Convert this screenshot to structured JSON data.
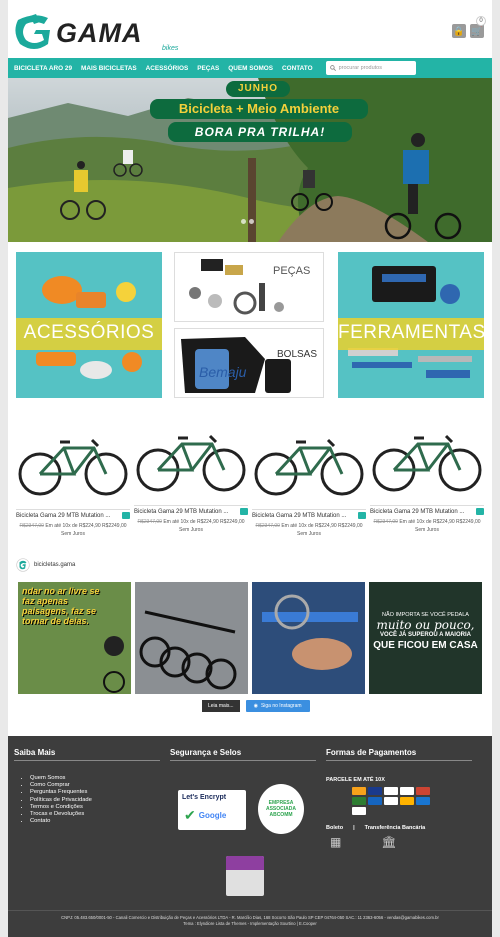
{
  "header": {
    "brand": "GAMA",
    "brand_sub": "bikes",
    "cart_count": "0"
  },
  "nav": {
    "items": [
      "BICICLETA ARO 29",
      "MAIS BICICLETAS",
      "ACESSÓRIOS",
      "PEÇAS",
      "QUEM SOMOS",
      "CONTATO"
    ],
    "search_placeholder": "procurar produtos"
  },
  "hero": {
    "line1": "JUNHO",
    "line2": "Bicicleta + Meio Ambiente",
    "line3": "BORA PRA TRILHA!"
  },
  "categories": {
    "accessories": "ACESSÓRIOS",
    "parts": "PEÇAS",
    "bags": "BOLSAS",
    "tools": "FERRAMENTAS",
    "bags_brand": "Bemaju"
  },
  "products": [
    {
      "name": "Bicicleta Gama 29 MTB Mutation ...",
      "old_price": "R$2347,00",
      "installment": "Em até 10x de R$224,90",
      "price": "R$2249,00",
      "note": "Sem Juros"
    },
    {
      "name": "Bicicleta Gama 29 MTB Mutation ...",
      "old_price": "R$2347,00",
      "installment": "Em até 10x de R$224,90",
      "price": "R$2249,00",
      "note": "Sem Juros"
    },
    {
      "name": "Bicicleta Gama 29 MTB Mutation ...",
      "old_price": "R$2347,00",
      "installment": "Em até 10x de R$224,90",
      "price": "R$2249,00",
      "note": "Sem Juros"
    },
    {
      "name": "Bicicleta Gama 29 MTB Mutation ...",
      "old_price": "R$2347,00",
      "installment": "Em até 10x de R$224,90",
      "price": "R$2249,00",
      "note": "Sem Juros"
    }
  ],
  "instagram": {
    "handle": "bicicletas.gama",
    "post1": "ndar no ar livre se faz apenas paisagens, faz se tornar de deias.",
    "post4a": "NÃO IMPORTA SE VOCÊ PEDALA",
    "post4b": "muito ou pouco,",
    "post4c": "VOCÊ JÁ SUPEROU A MAIORIA",
    "post4d": "QUE FICOU EM CASA",
    "load_more": "Leia mais...",
    "follow": "Siga no Instagram"
  },
  "footer": {
    "col1_title": "Saiba Mais",
    "links": [
      "Quem Somos",
      "Como Comprar",
      "Perguntas Frequentes",
      "Políticas de Privacidade",
      "Termos e Condições",
      "Trocas e Devoluções",
      "Contato"
    ],
    "col2_title": "Segurança e Selos",
    "letsencrypt": "Let's Encrypt",
    "google": "Google",
    "abcomm": "EMPRESA ASSOCIADA ABCOMM",
    "col3_title": "Formas de Pagamentos",
    "parcel": "PARCELE EM ATÉ 10X",
    "boleto": "Boleto",
    "sep": "|",
    "transfer": "Transferência Bancária",
    "copyright": "CNPJ: 05.483.650/0001-50 - Canali Comercio e Distribuição de Peças e Acessórios LTDA - R. Marcílio Dias, 168 Socorro São Paulo SP CEP 04764-050 SAC.: 11 2363-6056 - vendas@gamabikes.com.br",
    "theme": "Tema : Elyndiore Lista de Themes - Implementação Sourtino | E.Cooper"
  }
}
